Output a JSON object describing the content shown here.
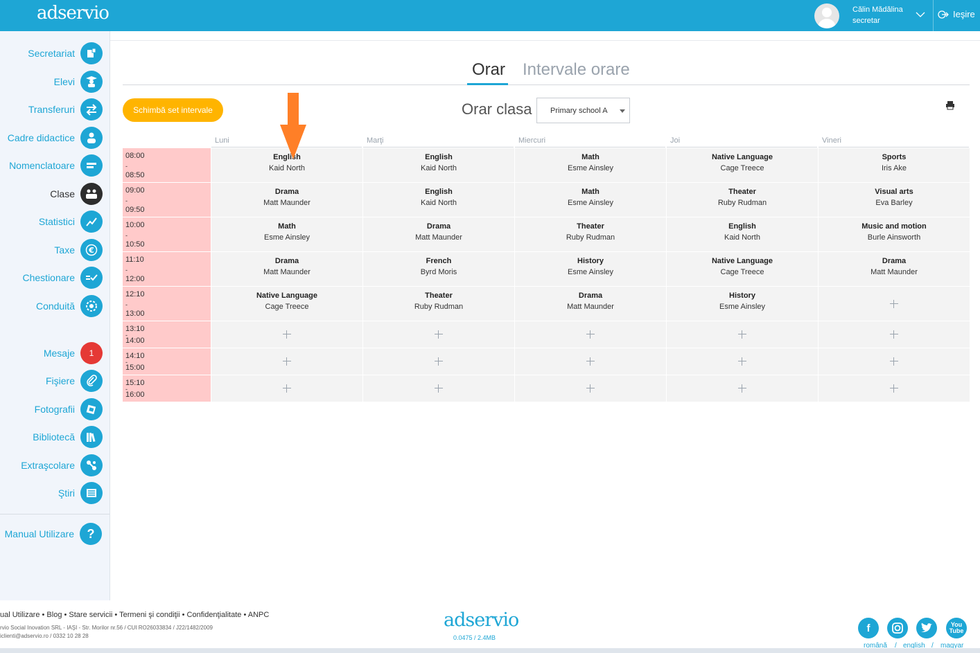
{
  "app": {
    "logo": "adservio",
    "user_name": "Călin Mădălina",
    "user_role": "secretar",
    "logout_label": "Ieşire"
  },
  "sidebar": {
    "items": [
      {
        "label": "Secretariat",
        "icon": "secretariat-icon"
      },
      {
        "label": "Elevi",
        "icon": "student-icon"
      },
      {
        "label": "Transferuri",
        "icon": "transfer-icon"
      },
      {
        "label": "Cadre didactice",
        "icon": "teacher-icon"
      },
      {
        "label": "Nomenclatoare",
        "icon": "nomenclature-icon"
      },
      {
        "label": "Clase",
        "icon": "classes-icon"
      },
      {
        "label": "Statistici",
        "icon": "chart-icon"
      },
      {
        "label": "Taxe",
        "icon": "euro-icon"
      },
      {
        "label": "Chestionare",
        "icon": "questionnaire-icon"
      },
      {
        "label": "Conduită",
        "icon": "conduct-icon"
      },
      {
        "label": "Mesaje",
        "icon": "messages-icon",
        "badge": "1"
      },
      {
        "label": "Fişiere",
        "icon": "paperclip-icon"
      },
      {
        "label": "Fotografii",
        "icon": "photo-icon"
      },
      {
        "label": "Bibliotecă",
        "icon": "library-icon"
      },
      {
        "label": "Extraşcolare",
        "icon": "extracurricular-icon"
      },
      {
        "label": "Ştiri",
        "icon": "news-icon"
      },
      {
        "label": "Manual Utilizare",
        "icon": "help-icon",
        "glyph": "?"
      }
    ]
  },
  "tabs": [
    {
      "label": "Orar",
      "active": true
    },
    {
      "label": "Intervale orare",
      "active": false
    }
  ],
  "toolbar": {
    "change_intervals_label": "Schimbă set intervale",
    "title": "Orar clasa",
    "class_selected": "Primary school A"
  },
  "days": [
    "Luni",
    "Marţi",
    "Miercuri",
    "Joi",
    "Vineri"
  ],
  "schedule": [
    {
      "start": "08:00",
      "end": "08:50",
      "cells": [
        {
          "subject": "English",
          "teacher": "Kaid North"
        },
        {
          "subject": "English",
          "teacher": "Kaid North"
        },
        {
          "subject": "Math",
          "teacher": "Esme Ainsley"
        },
        {
          "subject": "Native Language",
          "teacher": "Cage Treece"
        },
        {
          "subject": "Sports",
          "teacher": "Iris Ake"
        }
      ]
    },
    {
      "start": "09:00",
      "end": "09:50",
      "cells": [
        {
          "subject": "Drama",
          "teacher": "Matt Maunder"
        },
        {
          "subject": "English",
          "teacher": "Kaid North"
        },
        {
          "subject": "Math",
          "teacher": "Esme Ainsley"
        },
        {
          "subject": "Theater",
          "teacher": "Ruby Rudman"
        },
        {
          "subject": "Visual arts",
          "teacher": "Eva Barley"
        }
      ]
    },
    {
      "start": "10:00",
      "end": "10:50",
      "cells": [
        {
          "subject": "Math",
          "teacher": "Esme Ainsley"
        },
        {
          "subject": "Drama",
          "teacher": "Matt Maunder"
        },
        {
          "subject": "Theater",
          "teacher": "Ruby Rudman"
        },
        {
          "subject": "English",
          "teacher": "Kaid North"
        },
        {
          "subject": "Music and motion",
          "teacher": "Burle Ainsworth"
        }
      ]
    },
    {
      "start": "11:10",
      "end": "12:00",
      "cells": [
        {
          "subject": "Drama",
          "teacher": "Matt Maunder"
        },
        {
          "subject": "French",
          "teacher": "Byrd Moris"
        },
        {
          "subject": "History",
          "teacher": "Esme Ainsley"
        },
        {
          "subject": "Native Language",
          "teacher": "Cage Treece"
        },
        {
          "subject": "Drama",
          "teacher": "Matt Maunder"
        }
      ]
    },
    {
      "start": "12:10",
      "end": "13:00",
      "cells": [
        {
          "subject": "Native Language",
          "teacher": "Cage Treece"
        },
        {
          "subject": "Theater",
          "teacher": "Ruby Rudman"
        },
        {
          "subject": "Drama",
          "teacher": "Matt Maunder"
        },
        {
          "subject": "History",
          "teacher": "Esme Ainsley"
        },
        null
      ]
    },
    {
      "start": "13:10",
      "end": "14:00",
      "cells": [
        null,
        null,
        null,
        null,
        null
      ]
    },
    {
      "start": "14:10",
      "end": "15:00",
      "cells": [
        null,
        null,
        null,
        null,
        null
      ]
    },
    {
      "start": "15:10",
      "end": "16:00",
      "cells": [
        null,
        null,
        null,
        null,
        null
      ]
    }
  ],
  "footer": {
    "links": "ual Utilizare • Blog • Stare servicii • Termeni şi condiţii • Confidenţialitate • ANPC",
    "company": "rvio Social Inovation SRL - IAŞI - Str. Morilor nr.56 / CUI RO26033834 / J22/1482/2009",
    "contact": "iclienti@adservio.ro / 0332 10 28 28",
    "logo": "adservio",
    "version": "0.0475 / 2.4MB",
    "social": [
      "f",
      "ig",
      "tw",
      "yt"
    ],
    "languages": [
      "română",
      "english",
      "magyar"
    ]
  },
  "colors": {
    "brand": "#1ea6d5",
    "accent_button": "#ffb400",
    "time_bg": "#ffcaca",
    "badge_red": "#e53935",
    "annotation_arrow": "#ff7f27"
  }
}
